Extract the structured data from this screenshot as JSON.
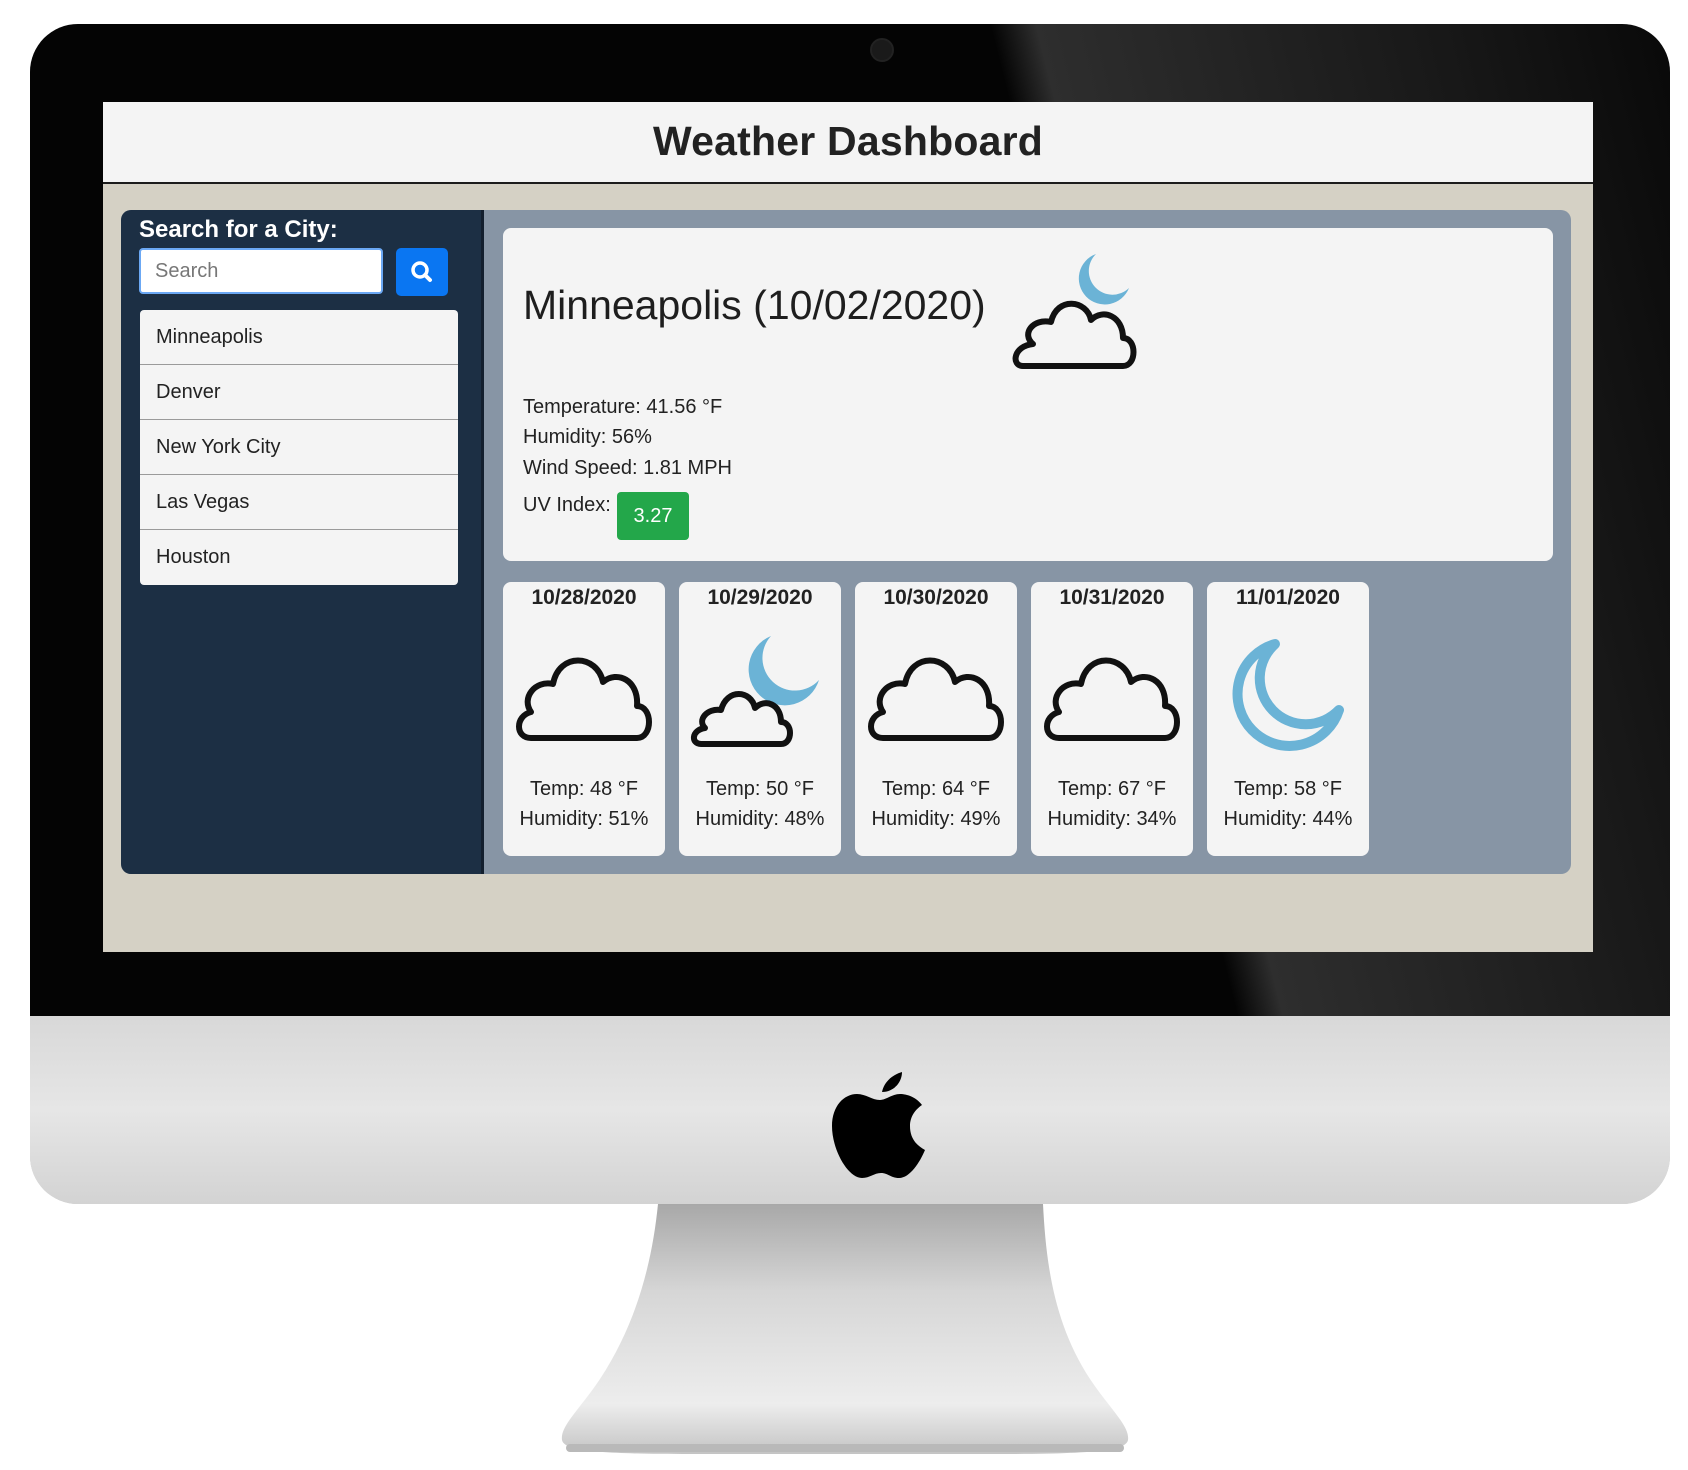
{
  "app": {
    "title": "Weather Dashboard"
  },
  "search": {
    "label": "Search for a City:",
    "placeholder": "Search",
    "button_icon": "search-icon"
  },
  "cities": [
    "Minneapolis",
    "Denver",
    "New York City",
    "Las Vegas",
    "Houston"
  ],
  "current": {
    "title": "Minneapolis (10/02/2020)",
    "icon": "cloud-moon-icon",
    "temperature": "Temperature: 41.56 °F",
    "humidity": "Humidity: 56%",
    "wind": "Wind Speed: 1.81 MPH",
    "uv_label": "UV Index:",
    "uv_value": "3.27",
    "uv_color": "#23a74a"
  },
  "forecast": [
    {
      "date": "10/28/2020",
      "icon": "cloud-icon",
      "temp": "Temp: 48 °F",
      "humidity": "Humidity: 51%"
    },
    {
      "date": "10/29/2020",
      "icon": "cloud-moon-icon",
      "temp": "Temp: 50 °F",
      "humidity": "Humidity: 48%"
    },
    {
      "date": "10/30/2020",
      "icon": "cloud-icon",
      "temp": "Temp: 64 °F",
      "humidity": "Humidity: 49%"
    },
    {
      "date": "10/31/2020",
      "icon": "cloud-icon",
      "temp": "Temp: 67 °F",
      "humidity": "Humidity: 34%"
    },
    {
      "date": "11/01/2020",
      "icon": "moon-icon",
      "temp": "Temp: 58 °F",
      "humidity": "Humidity: 44%"
    }
  ],
  "colors": {
    "sidebar": "#1c2f44",
    "panel": "#8795a5",
    "accent": "#0a76f2",
    "moon": "#6bb3d6"
  }
}
